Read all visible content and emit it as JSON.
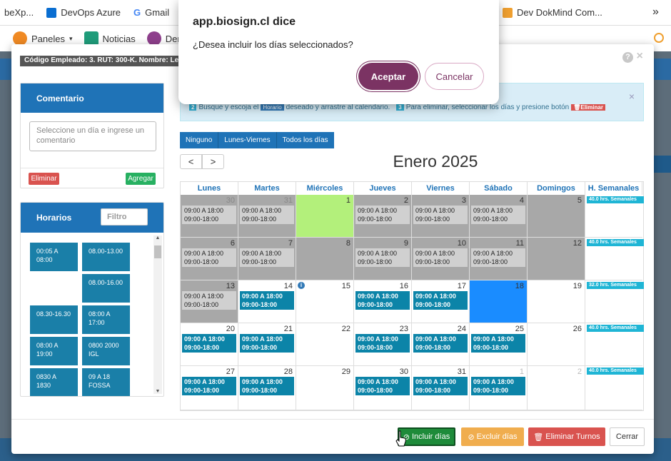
{
  "browser": {
    "bookmarks": [
      {
        "label": "beXp...",
        "color": "#1e6fd9"
      },
      {
        "label": "DevOps Azure",
        "color": "#0a6ed1"
      },
      {
        "label": "Gmail",
        "color": "#ea4335"
      },
      {
        "label": "",
        "color": "#ff0000"
      },
      {
        "label": "Dev DokMind Com...",
        "color": "#f0a030"
      }
    ],
    "more": "»"
  },
  "app_nav": [
    {
      "label": "Paneles",
      "color": "#f08a24"
    },
    {
      "label": "Noticias",
      "color": "#1f9c7a"
    },
    {
      "label": "Den",
      "color": "#8e3f8c"
    }
  ],
  "modal": {
    "employee_label": "Código Empleado: 3. RUT: 300-K. Nombre: Le",
    "help_icon": "?",
    "close_icon": "×"
  },
  "comment_panel": {
    "title": "Comentario",
    "placeholder": "Seleccione un día e ingrese un comentario",
    "delete_label": "Eliminar",
    "add_label": "Agregar"
  },
  "schedules_panel": {
    "title": "Horarios",
    "filter_placeholder": "Filtro",
    "items": [
      "00:05 A 08:00",
      "08.00-13.00",
      "08.00-16.00",
      "08.30-16.30",
      "08:00 A 17:00",
      "08:00 A 19:00",
      "0800 2000 IGL",
      "0830 A 1830",
      "09 A 18 FOSSA"
    ]
  },
  "info_bar": {
    "step2": "2",
    "text1": "Busque y escoja el",
    "tag": "Horario",
    "text2": "deseado y arrastre al calendario.",
    "step3": "3",
    "text3": "Para eliminar, seleccionar los días y presione botón",
    "delete_tag": "Eliminar",
    "close": "×"
  },
  "filters": [
    "Ninguno",
    "Lunes-Viernes",
    "Todos los días"
  ],
  "calendar": {
    "prev": "<",
    "next": ">",
    "month": "Enero 2025",
    "headers": [
      "Lunes",
      "Martes",
      "Miércoles",
      "Jueves",
      "Viernes",
      "Sábado",
      "Domingos",
      "H. Semanales"
    ],
    "shift_line1": "09:00 A 18:00",
    "shift_line2": "09:00-18:00",
    "weeks": [
      {
        "total": "40.0 hrs. Semanales",
        "days": [
          {
            "n": "30",
            "state": "gray",
            "shift": "gray",
            "other": true
          },
          {
            "n": "31",
            "state": "gray",
            "shift": "gray",
            "other": true
          },
          {
            "n": "1",
            "state": "green"
          },
          {
            "n": "2",
            "state": "gray",
            "shift": "gray"
          },
          {
            "n": "3",
            "state": "gray",
            "shift": "gray"
          },
          {
            "n": "4",
            "state": "gray",
            "shift": "gray"
          },
          {
            "n": "5",
            "state": "gray"
          }
        ]
      },
      {
        "total": "40.0 hrs. Semanales",
        "days": [
          {
            "n": "6",
            "state": "gray",
            "shift": "gray"
          },
          {
            "n": "7",
            "state": "gray",
            "shift": "gray"
          },
          {
            "n": "8",
            "state": "gray"
          },
          {
            "n": "9",
            "state": "gray",
            "shift": "gray"
          },
          {
            "n": "10",
            "state": "gray",
            "shift": "gray"
          },
          {
            "n": "11",
            "state": "gray",
            "shift": "gray"
          },
          {
            "n": "12",
            "state": "gray"
          }
        ]
      },
      {
        "total": "32.0 hrs. Semanales",
        "days": [
          {
            "n": "13",
            "state": "gray",
            "shift": "gray"
          },
          {
            "n": "14",
            "state": "white",
            "shift": "blue"
          },
          {
            "n": "15",
            "state": "white",
            "info": "i"
          },
          {
            "n": "16",
            "state": "white",
            "shift": "blue"
          },
          {
            "n": "17",
            "state": "white",
            "shift": "blue"
          },
          {
            "n": "18",
            "state": "selected"
          },
          {
            "n": "19",
            "state": "white"
          }
        ]
      },
      {
        "total": "40.0 hrs. Semanales",
        "days": [
          {
            "n": "20",
            "state": "white",
            "shift": "blue"
          },
          {
            "n": "21",
            "state": "white",
            "shift": "blue"
          },
          {
            "n": "22",
            "state": "white"
          },
          {
            "n": "23",
            "state": "white",
            "shift": "blue"
          },
          {
            "n": "24",
            "state": "white",
            "shift": "blue"
          },
          {
            "n": "25",
            "state": "white",
            "shift": "blue"
          },
          {
            "n": "26",
            "state": "white"
          }
        ]
      },
      {
        "total": "40.0 hrs. Semanales",
        "days": [
          {
            "n": "27",
            "state": "white",
            "shift": "blue"
          },
          {
            "n": "28",
            "state": "white",
            "shift": "blue"
          },
          {
            "n": "29",
            "state": "white"
          },
          {
            "n": "30",
            "state": "white",
            "shift": "blue"
          },
          {
            "n": "31",
            "state": "white",
            "shift": "blue"
          },
          {
            "n": "1",
            "state": "white",
            "shift": "blue",
            "other": true
          },
          {
            "n": "2",
            "state": "white",
            "other": true
          }
        ]
      }
    ]
  },
  "footer": {
    "include": "Incluir días",
    "exclude": "Excluir días",
    "delete": "Eliminar Turnos",
    "close": "Cerrar"
  },
  "dialog": {
    "title": "app.biosign.cl dice",
    "message": "¿Desea incluir los días seleccionados?",
    "ok": "Aceptar",
    "cancel": "Cancelar"
  },
  "colors": {
    "primary": "#1f73b7",
    "shift_blue": "#0c84a8",
    "green_day": "#b3f07b",
    "selected_day": "#1a8cff",
    "dialog_accent": "#7b3363"
  }
}
